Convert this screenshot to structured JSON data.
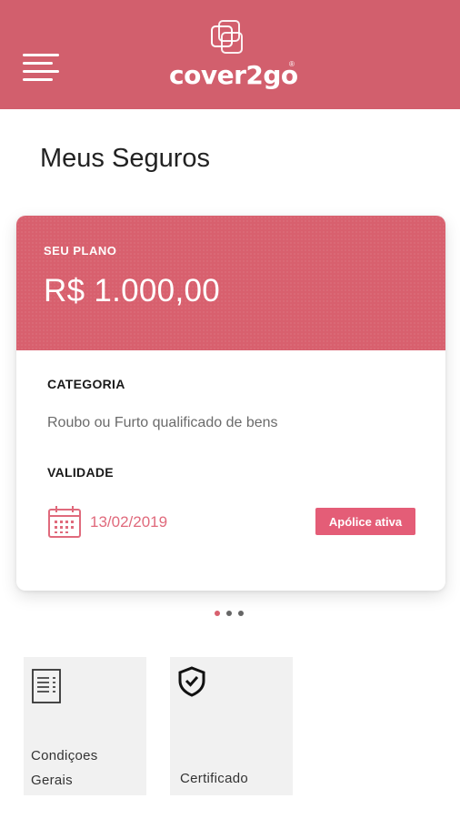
{
  "header": {
    "brand": "cover2go",
    "brand_mark": "®",
    "menu_icon": "hamburger-menu-icon",
    "logo_icon": "overlapping-squares-logo",
    "background_color": "#d25f6d"
  },
  "page": {
    "title": "Meus Seguros"
  },
  "plan_card": {
    "plan_label": "SEU PLANO",
    "plan_value": "R$ 1.000,00",
    "category_label": "CATEGORIA",
    "category_value": "Roubo ou Furto qualificado de bens",
    "validity_label": "VALIDADE",
    "validity_date": "13/02/2019",
    "calendar_icon": "calendar-icon",
    "status": "Apólice ativa",
    "accent_color": "#d8606e",
    "status_color": "#e45d77"
  },
  "carousel": {
    "page_count": 3,
    "active_index": 0,
    "active_color": "#d8606e",
    "inactive_color": "#666666"
  },
  "documents": [
    {
      "label_line1": "Condiçoes",
      "label_line2": "Gerais",
      "icon": "document-icon"
    },
    {
      "label_line1": "Certificado",
      "icon": "shield-check-icon"
    }
  ]
}
